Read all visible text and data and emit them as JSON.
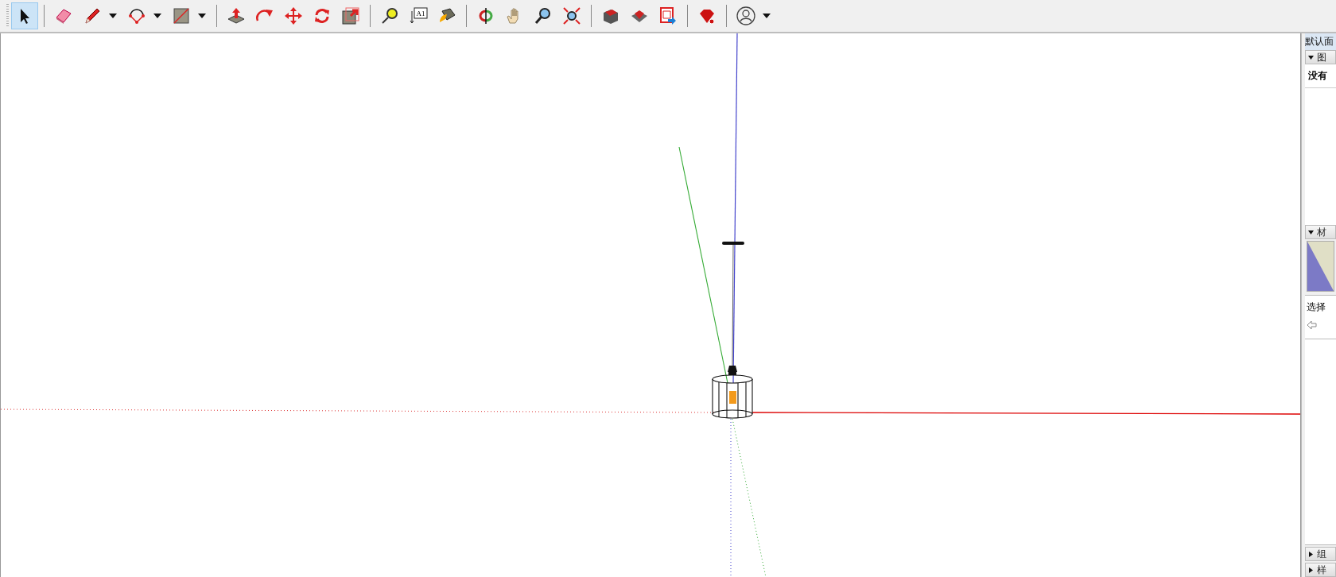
{
  "toolbar": {
    "groups": [
      [
        {
          "selected": true
        }
      ],
      [
        {
          "selected": false
        },
        {
          "selected": false,
          "menu": true
        },
        {
          "selected": false,
          "menu": true
        },
        {
          "selected": false,
          "menu": true
        }
      ],
      [
        {
          "selected": false
        },
        {
          "selected": false
        },
        {
          "selected": false
        },
        {
          "selected": false
        },
        {
          "selected": false
        }
      ],
      [
        {
          "selected": false
        },
        {
          "selected": false,
          "label": "A1"
        },
        {
          "selected": false
        }
      ],
      [
        {
          "selected": false
        },
        {
          "selected": false
        },
        {
          "selected": false
        },
        {
          "selected": false
        }
      ],
      [
        {
          "selected": false
        },
        {
          "selected": false
        },
        {
          "selected": false
        }
      ],
      [
        {
          "selected": false
        }
      ],
      [
        {
          "selected": false,
          "menu": true
        }
      ]
    ]
  },
  "tray": {
    "title": "默认面",
    "panels": [
      {
        "title": "图",
        "expanded": true,
        "kind": "info",
        "text": "没有"
      },
      {
        "title": "材",
        "expanded": true,
        "kind": "materials",
        "tab": "选择"
      },
      {
        "title": "组",
        "expanded": false,
        "kind": "collapsed"
      },
      {
        "title": "样",
        "expanded": false,
        "kind": "collapsed"
      }
    ]
  }
}
